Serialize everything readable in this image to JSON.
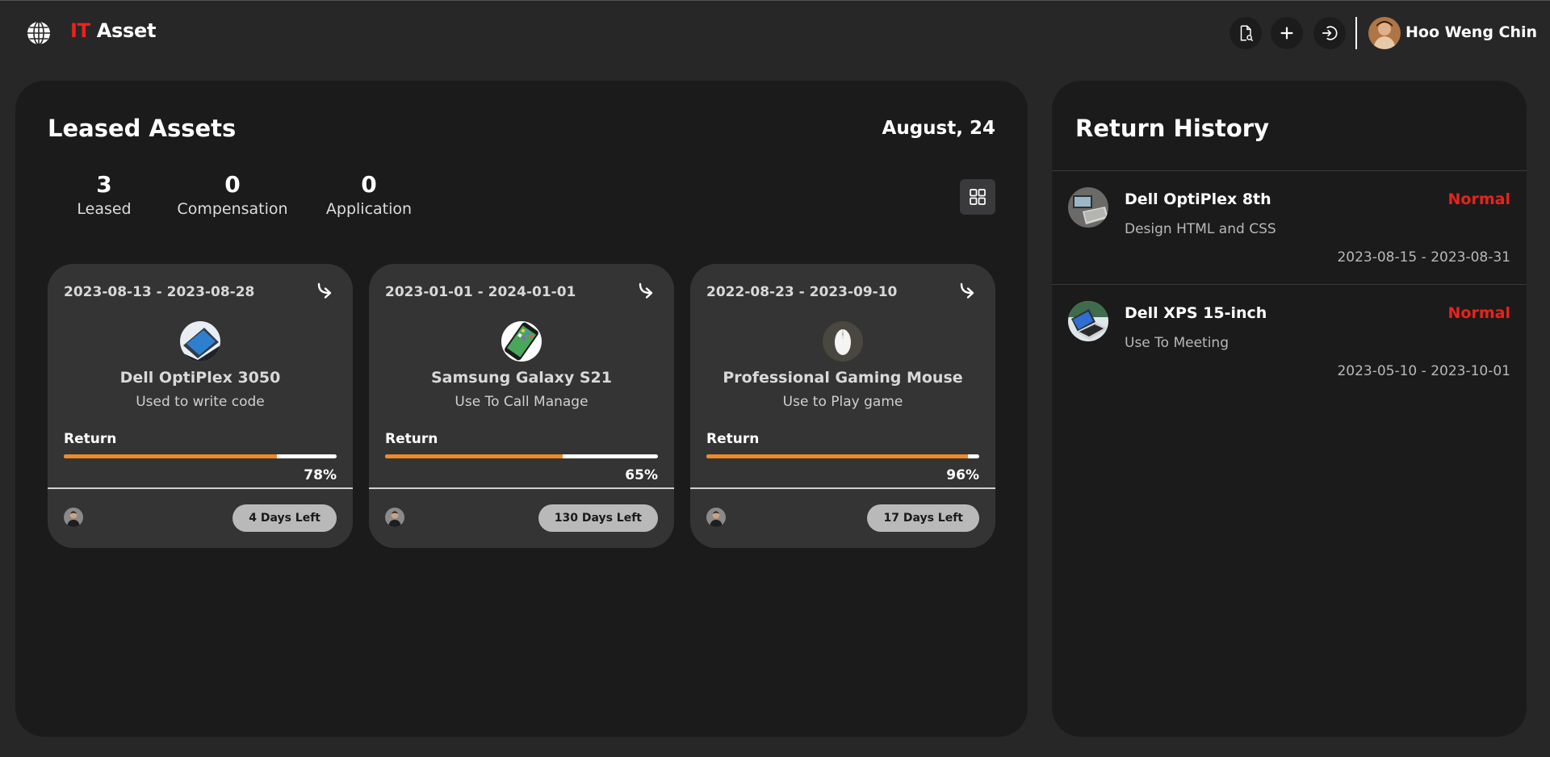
{
  "header": {
    "brand_prefix": "IT",
    "brand_suffix": " Asset",
    "user_name": "Hoo Weng Chin",
    "buttons": [
      "document-search-icon",
      "plus-icon",
      "logout-icon"
    ]
  },
  "leased_assets": {
    "title": "Leased Assets",
    "date": "August, 24",
    "stats": [
      {
        "value": "3",
        "label": "Leased"
      },
      {
        "value": "0",
        "label": "Compensation"
      },
      {
        "value": "0",
        "label": "Application"
      }
    ],
    "cards": [
      {
        "dates": "2023-08-13 - 2023-08-28",
        "name": "Dell OptiPlex 3050",
        "description": "Used to write code",
        "return_label": "Return",
        "progress": 78,
        "percent": "78%",
        "days_left": "4 Days Left"
      },
      {
        "dates": "2023-01-01 - 2024-01-01",
        "name": "Samsung Galaxy S21",
        "description": "Use To Call Manage",
        "return_label": "Return",
        "progress": 65,
        "percent": "65%",
        "days_left": "130 Days Left"
      },
      {
        "dates": "2022-08-23 - 2023-09-10",
        "name": "Professional Gaming Mouse",
        "description": "Use to Play game",
        "return_label": "Return",
        "progress": 96,
        "percent": "96%",
        "days_left": "17 Days Left"
      }
    ]
  },
  "return_history": {
    "title": "Return History",
    "items": [
      {
        "name": "Dell OptiPlex 8th",
        "status": "Normal",
        "description": "Design HTML and CSS",
        "dates": "2023-08-15 - 2023-08-31"
      },
      {
        "name": "Dell XPS 15-inch",
        "status": "Normal",
        "description": "Use To Meeting",
        "dates": "2023-05-10 - 2023-10-01"
      }
    ]
  },
  "colors": {
    "accent_red": "#e8231c",
    "progress_orange": "#ef8a24",
    "status_normal": "#e8231c"
  }
}
